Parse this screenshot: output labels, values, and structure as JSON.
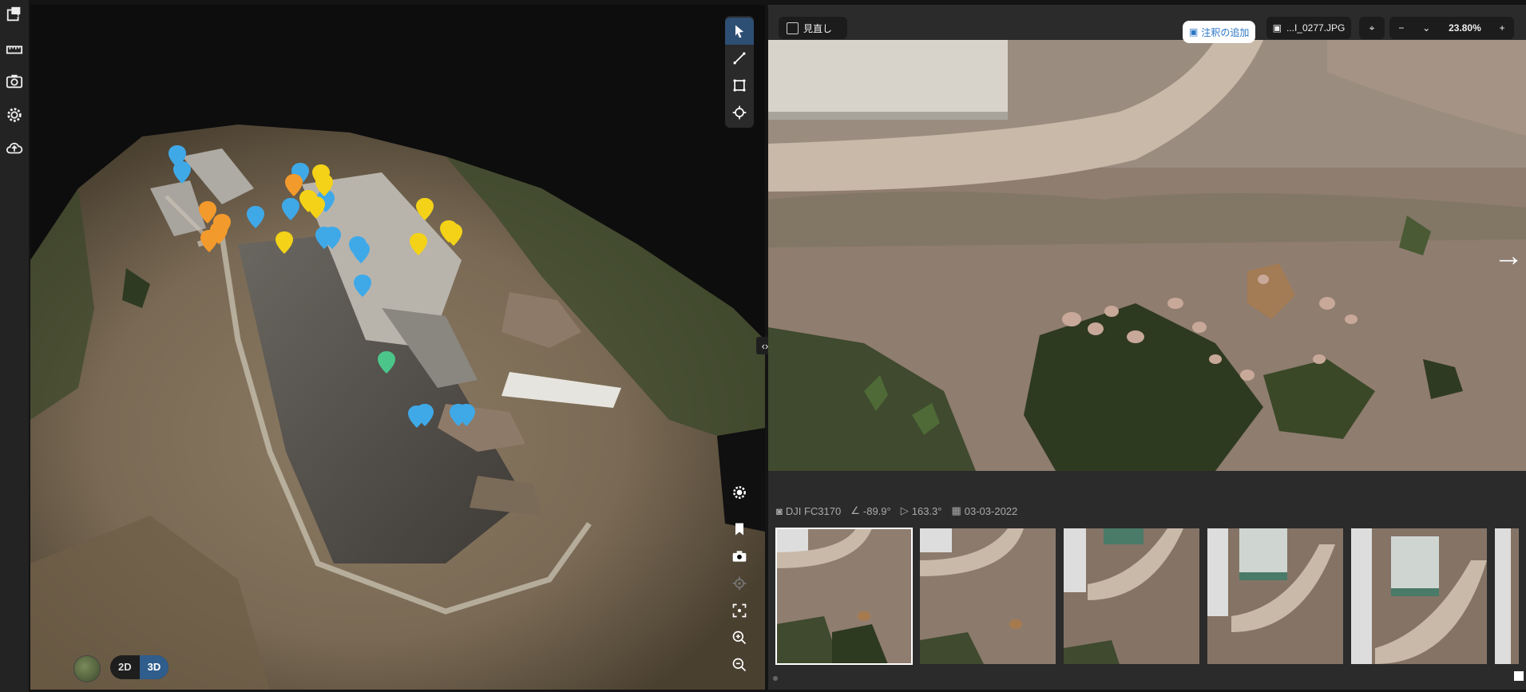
{
  "toolbar_left": {
    "items": [
      {
        "icon": "layers-image-icon"
      },
      {
        "icon": "ruler-icon"
      },
      {
        "icon": "camera-icon"
      },
      {
        "icon": "gear-icon"
      },
      {
        "icon": "cloud-upload-icon"
      }
    ]
  },
  "viewer3d": {
    "tools": [
      {
        "icon": "cursor-icon",
        "active": true
      },
      {
        "icon": "line-measure-icon"
      },
      {
        "icon": "area-measure-icon"
      },
      {
        "icon": "target-icon"
      }
    ],
    "nav_tools": [
      "settings-gear-icon",
      "bookmark-icon",
      "camera-icon",
      "locate-icon",
      "fit-view-icon",
      "zoom-in-icon",
      "zoom-out-icon"
    ],
    "view_toggle": {
      "label_2d": "2D",
      "label_3d": "3D",
      "selected": "3D"
    },
    "pin_colors": {
      "blue": "#3fa9e8",
      "orange": "#f39a2c",
      "yellow": "#f3d218",
      "green": "#4cc58a"
    }
  },
  "photo_viewer": {
    "heading_checkbox_label": "見直し",
    "add_annotation_label": "注釈の追加",
    "file_name": "...I_0277.JPG",
    "zoom_percent": "23.80%"
  },
  "exif": {
    "camera": "DJI FC3170",
    "pitch": "-89.9°",
    "heading": "163.3°",
    "date": "03-03-2022"
  },
  "filmstrip": {
    "selected_index": 0,
    "count": 6
  }
}
